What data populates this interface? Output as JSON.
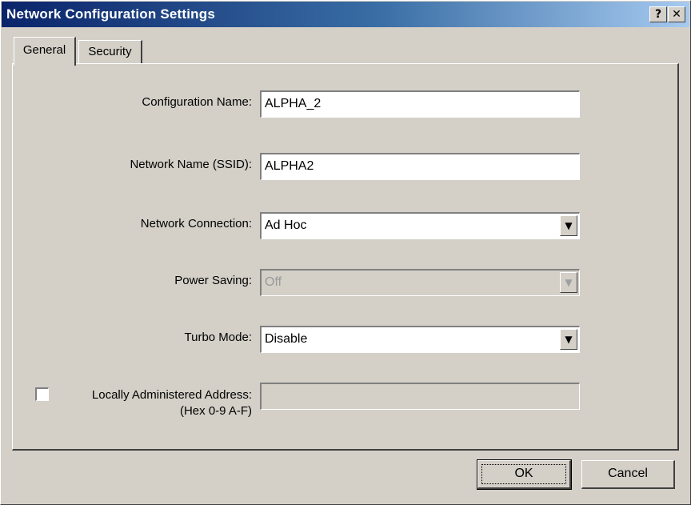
{
  "window": {
    "title": "Network Configuration Settings",
    "help_label": "?",
    "close_label": "✕"
  },
  "tabs": [
    {
      "label": "General",
      "active": true
    },
    {
      "label": "Security",
      "active": false
    }
  ],
  "form": {
    "config_name_label": "Configuration Name:",
    "config_name_value": "ALPHA_2",
    "ssid_label": "Network Name (SSID):",
    "ssid_value": "ALPHA2",
    "connection_label": "Network Connection:",
    "connection_value": "Ad Hoc",
    "power_label": "Power Saving:",
    "power_value": "Off",
    "turbo_label": "Turbo Mode:",
    "turbo_value": "Disable",
    "laa_label_line1": "Locally Administered Address:",
    "laa_label_line2": "(Hex 0-9 A-F)",
    "laa_value": ""
  },
  "buttons": {
    "ok": "OK",
    "cancel": "Cancel"
  },
  "colors": {
    "titlebar_start": "#0a246a",
    "titlebar_end": "#a6caf0",
    "face": "#d4d0c8"
  },
  "icons": {
    "dropdown": "chevron-down-icon",
    "help": "help-icon",
    "close": "close-icon"
  }
}
